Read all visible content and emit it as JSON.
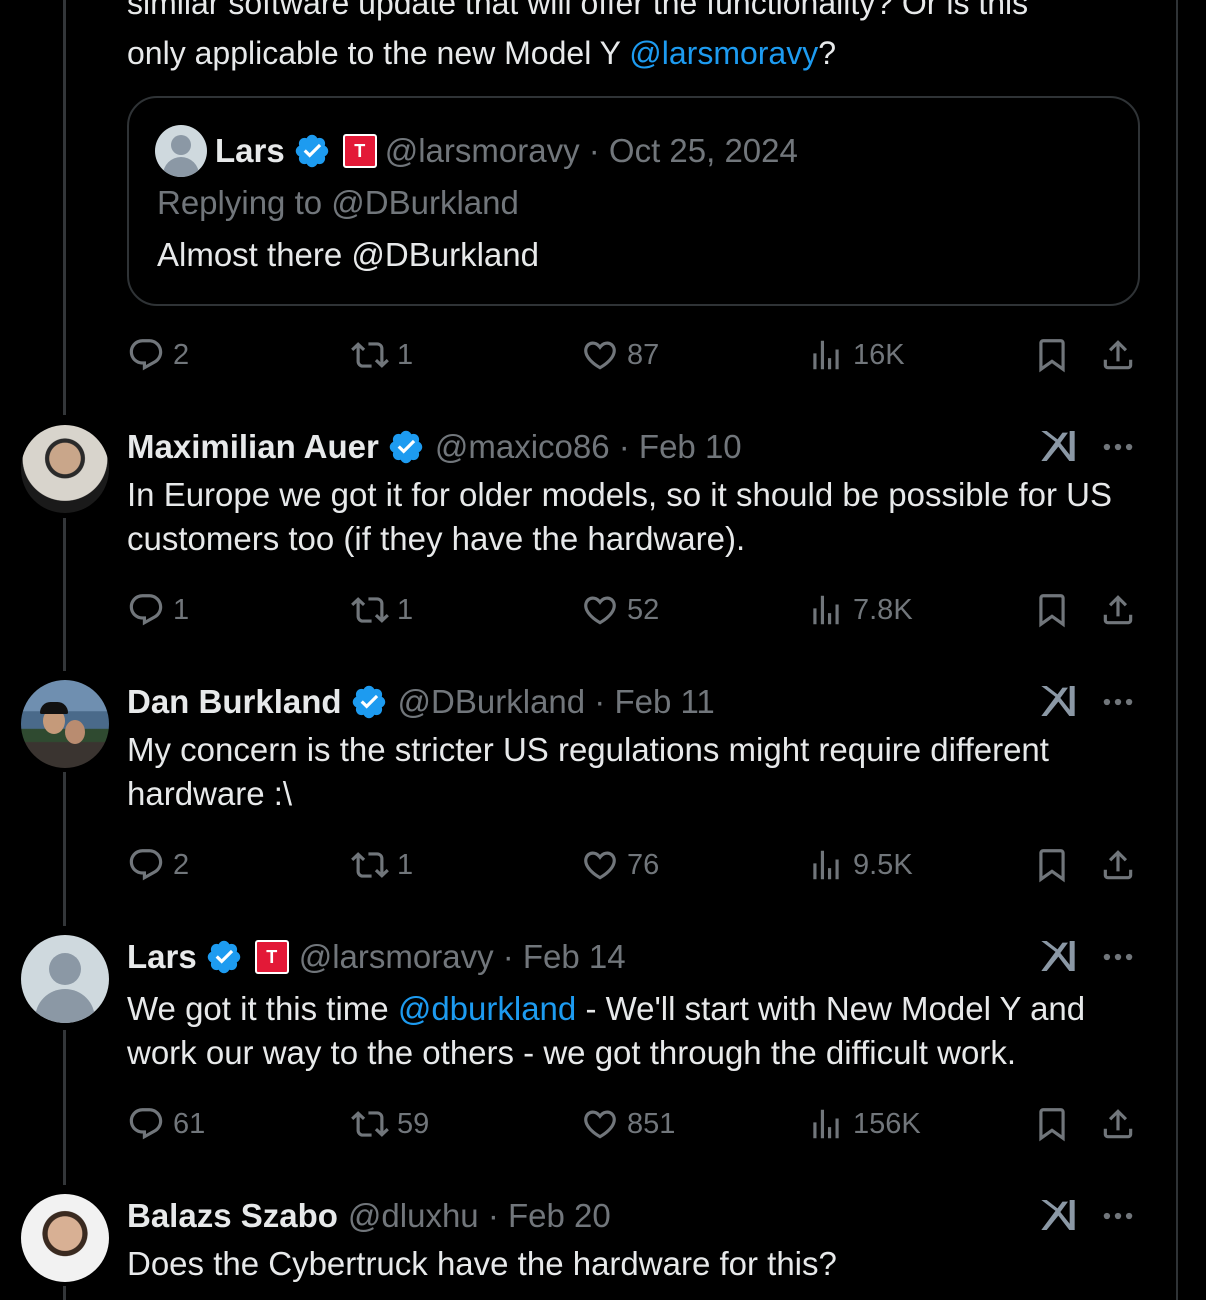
{
  "top_tweet": {
    "text_line1": "similar software update that will offer the functionality? Or is this",
    "text_line2_prefix": "only applicable to the new Model Y ",
    "text_line2_mention": "@larsmoravy",
    "text_line2_suffix": "?"
  },
  "quote": {
    "name": "Lars",
    "meta": "@larsmoravy · Oct 25, 2024",
    "replying_to": "Replying to @DBurkland",
    "text": "Almost there @DBurkland"
  },
  "top_actions": {
    "replies": "2",
    "reposts": "1",
    "likes": "87",
    "views": "16K"
  },
  "replies": [
    {
      "name": "Maximilian Auer",
      "meta": "@maxico86 · Feb 10",
      "text": "In Europe we got it for older models, so it should be possible for US customers too (if they have the hardware).",
      "actions": {
        "replies": "1",
        "reposts": "1",
        "likes": "52",
        "views": "7.8K"
      }
    },
    {
      "name": "Dan Burkland",
      "meta": "@DBurkland · Feb 11",
      "text": "My concern is the stricter US regulations might require different hardware :\\",
      "actions": {
        "replies": "2",
        "reposts": "1",
        "likes": "76",
        "views": "9.5K"
      }
    },
    {
      "name": "Lars",
      "meta": "@larsmoravy · Feb 14",
      "text_prefix": "We got it this time ",
      "text_mention": "@dburkland",
      "text_suffix": " - We'll start with New Model Y and work our way to the others - we got through the difficult work.",
      "actions": {
        "replies": "61",
        "reposts": "59",
        "likes": "851",
        "views": "156K"
      }
    },
    {
      "name": "Balazs Szabo",
      "meta": "@dluxhu · Feb 20",
      "text": "Does the Cybertruck have the hardware for this?"
    }
  ],
  "tesla_badge_letter": "T",
  "colors": {
    "accent": "#1d9bf0",
    "muted": "#71767b",
    "text": "#e7e9ea",
    "background": "#000000",
    "tesla_red": "#e31937"
  }
}
